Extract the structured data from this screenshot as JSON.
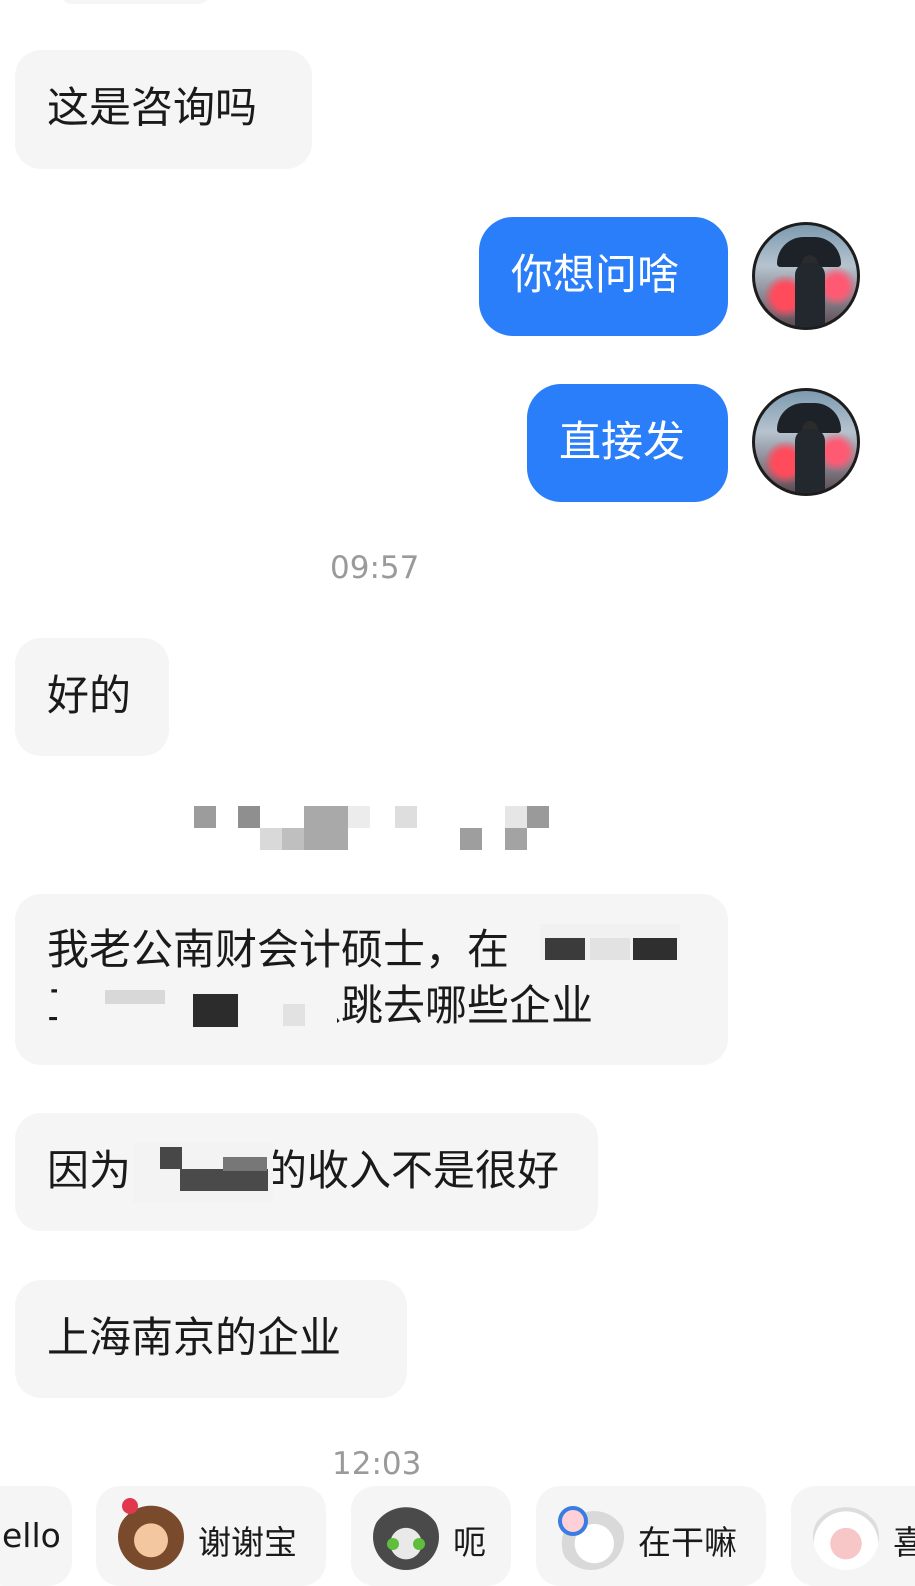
{
  "messages": [
    {
      "side": "in",
      "text": "这是咨询吗"
    },
    {
      "side": "out",
      "text": "你想问啥"
    },
    {
      "side": "out",
      "text": "直接发"
    },
    {
      "side": "in",
      "text": "好的"
    },
    {
      "side": "in",
      "line1": "我老公南财会计硕士，在",
      "line2": "工作两年，可以跳去哪些企业"
    },
    {
      "side": "in",
      "text_a": "因为",
      "text_b": "的收入不是很好"
    },
    {
      "side": "in",
      "text": "上海南京的企业"
    }
  ],
  "timestamps": [
    "09:57",
    "12:03"
  ],
  "quick_replies": [
    {
      "label": "ello",
      "icon": "none"
    },
    {
      "label": "谢谢宝",
      "icon": "monkey-sticker-icon"
    },
    {
      "label": "呃",
      "icon": "cat-sticker-icon"
    },
    {
      "label": "在干嘛",
      "icon": "magnifier-ghost-sticker-icon"
    },
    {
      "label": "喜",
      "icon": "sheep-sticker-icon"
    }
  ],
  "colors": {
    "outgoing_bubble": "#2a7ef9",
    "incoming_bubble": "#f5f5f5",
    "timestamp": "#9a9a9a"
  }
}
